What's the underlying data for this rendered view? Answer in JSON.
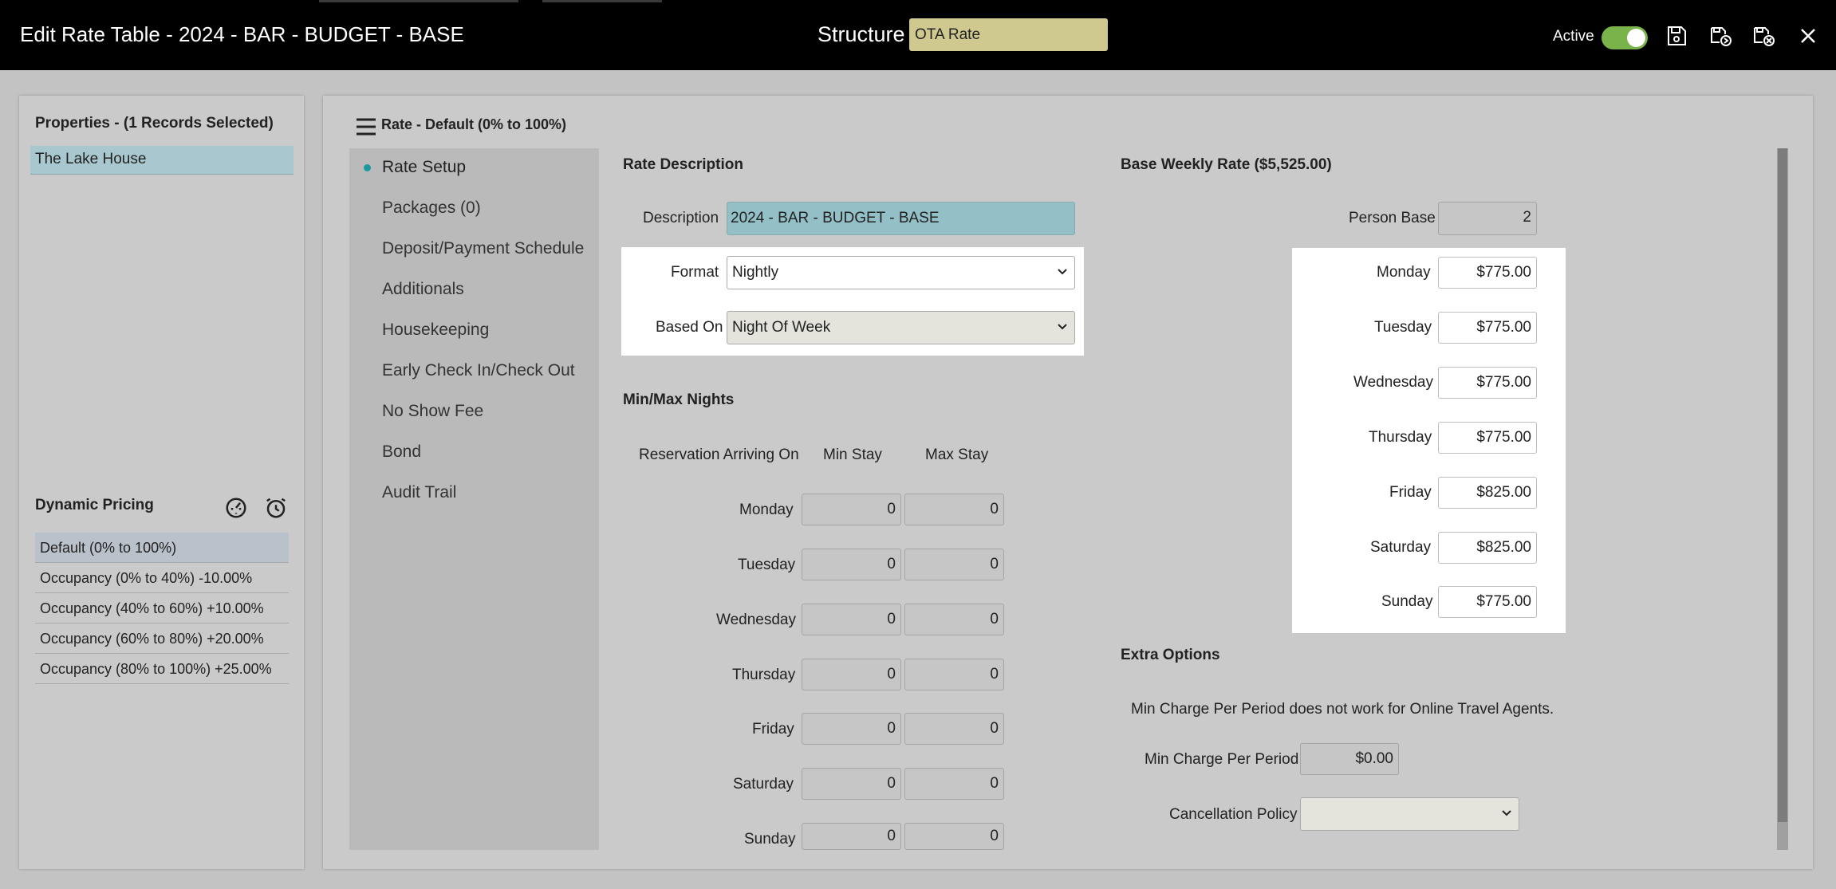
{
  "window": {
    "title": "Edit Rate Table - 2024 - BAR - BUDGET - BASE",
    "structure_label": "Structure",
    "structure_value": "OTA Rate",
    "active_label": "Active",
    "active_on": true
  },
  "properties": {
    "heading": "Properties - (1 Records Selected)",
    "items": [
      "The Lake House"
    ]
  },
  "dynamic_pricing": {
    "heading": "Dynamic Pricing",
    "rows": [
      "Default (0% to 100%)",
      "Occupancy (0% to 40%) -10.00%",
      "Occupancy (40% to 60%) +10.00%",
      "Occupancy (60% to 80%) +20.00%",
      "Occupancy (80% to 100%) +25.00%"
    ]
  },
  "main": {
    "header": "Rate - Default (0% to 100%)",
    "menu": [
      "Rate Setup",
      "Packages (0)",
      "Deposit/Payment Schedule",
      "Additionals",
      "Housekeeping",
      "Early Check In/Check Out",
      "No Show Fee",
      "Bond",
      "Audit Trail"
    ],
    "rate_description": {
      "heading": "Rate Description",
      "description_label": "Description",
      "description_value": "2024 - BAR - BUDGET - BASE",
      "format_label": "Format",
      "format_value": "Nightly",
      "based_on_label": "Based On",
      "based_on_value": "Night Of Week"
    },
    "min_max": {
      "heading": "Min/Max Nights",
      "col_arriving": "Reservation Arriving On",
      "col_min": "Min Stay",
      "col_max": "Max Stay",
      "rows": [
        {
          "day": "Monday",
          "min": "0",
          "max": "0"
        },
        {
          "day": "Tuesday",
          "min": "0",
          "max": "0"
        },
        {
          "day": "Wednesday",
          "min": "0",
          "max": "0"
        },
        {
          "day": "Thursday",
          "min": "0",
          "max": "0"
        },
        {
          "day": "Friday",
          "min": "0",
          "max": "0"
        },
        {
          "day": "Saturday",
          "min": "0",
          "max": "0"
        },
        {
          "day": "Sunday",
          "min": "0",
          "max": "0"
        }
      ]
    },
    "base_weekly": {
      "heading": "Base Weekly Rate ($5,525.00)",
      "person_base_label": "Person Base",
      "person_base_value": "2",
      "rates": [
        {
          "day": "Monday",
          "value": "$775.00"
        },
        {
          "day": "Tuesday",
          "value": "$775.00"
        },
        {
          "day": "Wednesday",
          "value": "$775.00"
        },
        {
          "day": "Thursday",
          "value": "$775.00"
        },
        {
          "day": "Friday",
          "value": "$825.00"
        },
        {
          "day": "Saturday",
          "value": "$825.00"
        },
        {
          "day": "Sunday",
          "value": "$775.00"
        }
      ]
    },
    "extra_options": {
      "heading": "Extra Options",
      "note": "Min Charge Per Period does not work for Online Travel Agents.",
      "min_charge_label": "Min Charge Per Period",
      "min_charge_value": "$0.00",
      "cancellation_label": "Cancellation Policy",
      "cancellation_value": ""
    }
  }
}
